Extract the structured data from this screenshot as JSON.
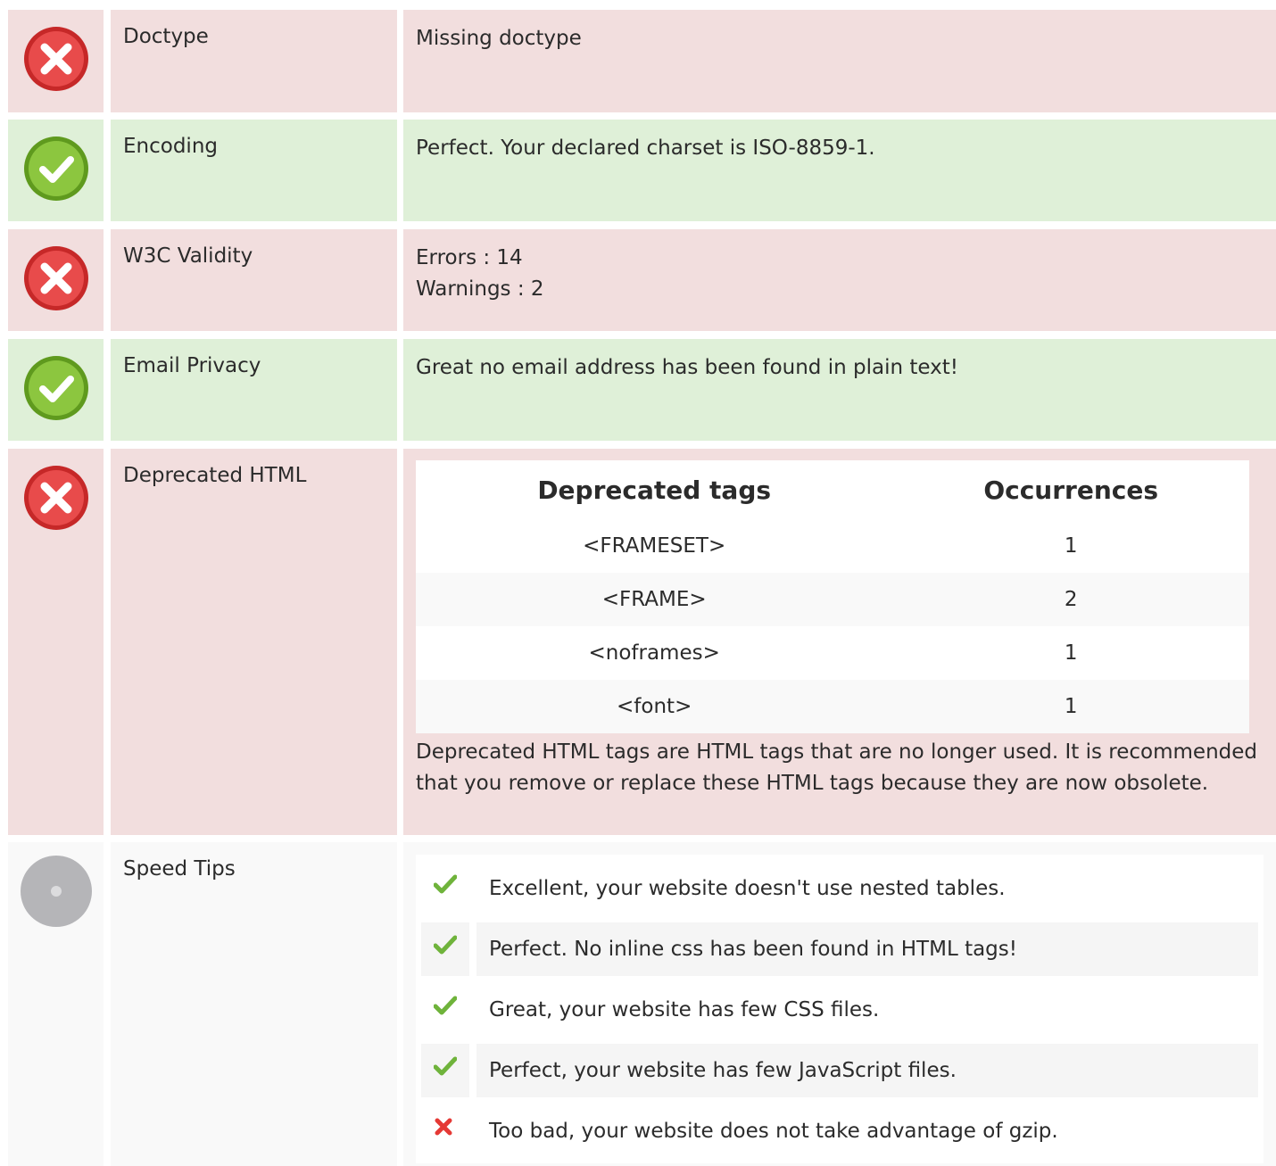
{
  "colors": {
    "error_bg": "#f2dede",
    "ok_bg": "#dff0d8",
    "info_bg": "#f9f9f9",
    "ok_green": "#8cc63f",
    "error_red": "#e53935",
    "neutral_grey": "#b5b5b8"
  },
  "rows": {
    "doctype": {
      "status": "error",
      "label": "Doctype",
      "value": "Missing doctype"
    },
    "encoding": {
      "status": "ok",
      "label": "Encoding",
      "value": "Perfect. Your declared charset is ISO-8859-1."
    },
    "w3c": {
      "status": "error",
      "label": "W3C Validity",
      "errors": "Errors : 14",
      "warnings": "Warnings : 2"
    },
    "email": {
      "status": "ok",
      "label": "Email Privacy",
      "value": "Great no email address has been found in plain text!"
    },
    "deprecated": {
      "status": "error",
      "label": "Deprecated HTML",
      "headers": [
        "Deprecated tags",
        "Occurrences"
      ],
      "tags": [
        {
          "tag": "<FRAMESET>",
          "count": "1"
        },
        {
          "tag": "<FRAME>",
          "count": "2"
        },
        {
          "tag": "<noframes>",
          "count": "1"
        },
        {
          "tag": "<font>",
          "count": "1"
        }
      ],
      "note": "Deprecated HTML tags are HTML tags that are no longer used. It is recommended that you remove or replace these HTML tags because they are now obsolete."
    },
    "speed": {
      "status": "info",
      "label": "Speed Tips",
      "tips": [
        {
          "icon": "check-icon",
          "text": "Excellent, your website doesn't use nested tables."
        },
        {
          "icon": "check-icon",
          "text": "Perfect. No inline css has been found in HTML tags!"
        },
        {
          "icon": "check-icon",
          "text": "Great, your website has few CSS files."
        },
        {
          "icon": "check-icon",
          "text": "Perfect, your website has few JavaScript files."
        },
        {
          "icon": "cross-icon",
          "text": "Too bad, your website does not take advantage of gzip."
        }
      ]
    }
  }
}
